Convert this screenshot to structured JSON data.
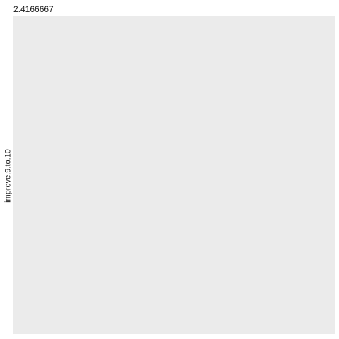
{
  "chart_data": {
    "type": "scatter",
    "title": "2.4166667",
    "ylabel": "improve.9.to.10",
    "xlabel": "",
    "series": [],
    "grid": false,
    "background": "#ebebeb"
  }
}
